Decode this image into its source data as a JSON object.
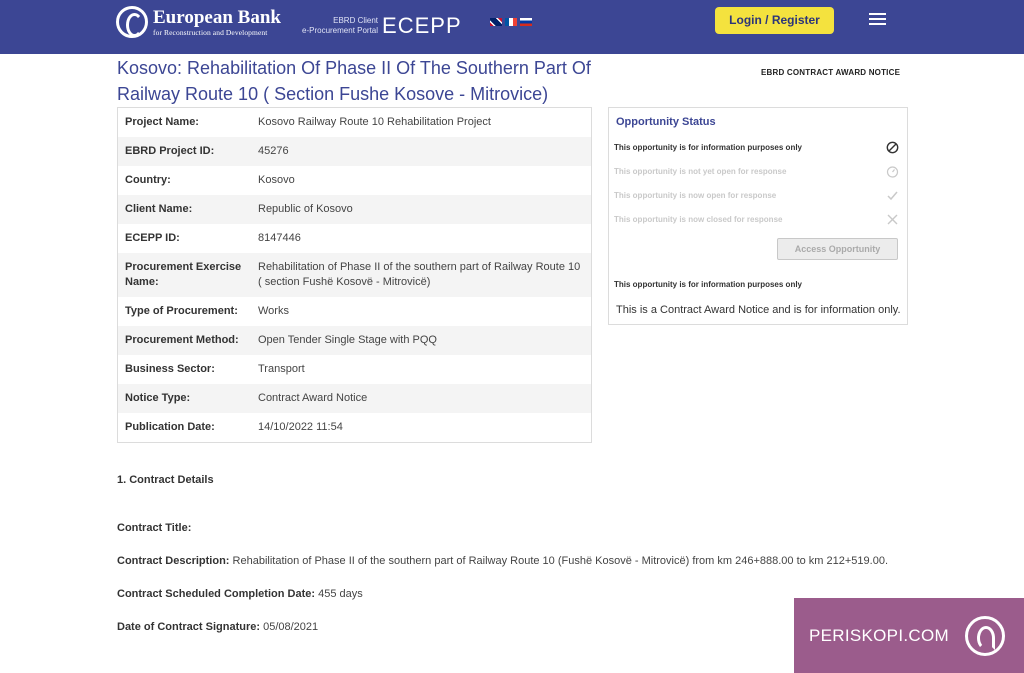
{
  "header": {
    "logo_line1": "European Bank",
    "logo_line2": "for Reconstruction and Development",
    "ecepp_small_line1": "EBRD Client",
    "ecepp_small_line2": "e-Procurement Portal",
    "ecepp_big": "ECEPP",
    "login_label": "Login / Register",
    "brand_color": "#3c4694",
    "button_color": "#f4e23e"
  },
  "page": {
    "title": "Kosovo: Rehabilitation Of Phase II Of The Southern Part Of Railway Route 10 ( Section Fushe Kosove - Mitrovice)",
    "notice_label": "EBRD CONTRACT AWARD NOTICE"
  },
  "info": [
    {
      "key": "Project Name:",
      "value": "Kosovo Railway Route 10 Rehabilitation Project"
    },
    {
      "key": "EBRD Project ID:",
      "value": "45276"
    },
    {
      "key": "Country:",
      "value": "Kosovo"
    },
    {
      "key": "Client Name:",
      "value": "Republic of Kosovo"
    },
    {
      "key": "ECEPP ID:",
      "value": "8147446"
    },
    {
      "key": "Procurement Exercise Name:",
      "value": "Rehabilitation of Phase II of the southern part of Railway Route 10 ( section Fushë Kosovë - Mitrovicë)"
    },
    {
      "key": "Type of Procurement:",
      "value": "Works"
    },
    {
      "key": "Procurement Method:",
      "value": "Open Tender Single Stage with PQQ"
    },
    {
      "key": "Business Sector:",
      "value": "Transport"
    },
    {
      "key": "Notice Type:",
      "value": "Contract Award Notice"
    },
    {
      "key": "Publication Date:",
      "value": "14/10/2022 11:54"
    }
  ],
  "status": {
    "title": "Opportunity Status",
    "items": [
      {
        "label": "This opportunity is for information purposes only",
        "icon": "ban-icon"
      },
      {
        "label": "This opportunity is not yet open for response",
        "icon": "clock-icon"
      },
      {
        "label": "This opportunity is now open for response",
        "icon": "check-icon"
      },
      {
        "label": "This opportunity is now closed for response",
        "icon": "close-icon"
      }
    ],
    "access_label": "Access Opportunity",
    "footer1": "This opportunity is for information purposes only",
    "footer2": "This is a Contract Award Notice and is for information only."
  },
  "contract": {
    "heading": "1. Contract Details",
    "title_label": "Contract Title:",
    "description_label": "Contract Description:",
    "description_value": "Rehabilitation of Phase II of the southern part of Railway Route 10 (Fushë Kosovë - Mitrovicë) from km 246+888.00 to km 212+519.00.",
    "completion_label": "Contract Scheduled Completion Date:",
    "completion_value": "455 days",
    "signature_label": "Date of Contract Signature:",
    "signature_value": "05/08/2021"
  },
  "watermark": {
    "text": "PERISKOPI.COM",
    "color": "#9b5c8c"
  }
}
